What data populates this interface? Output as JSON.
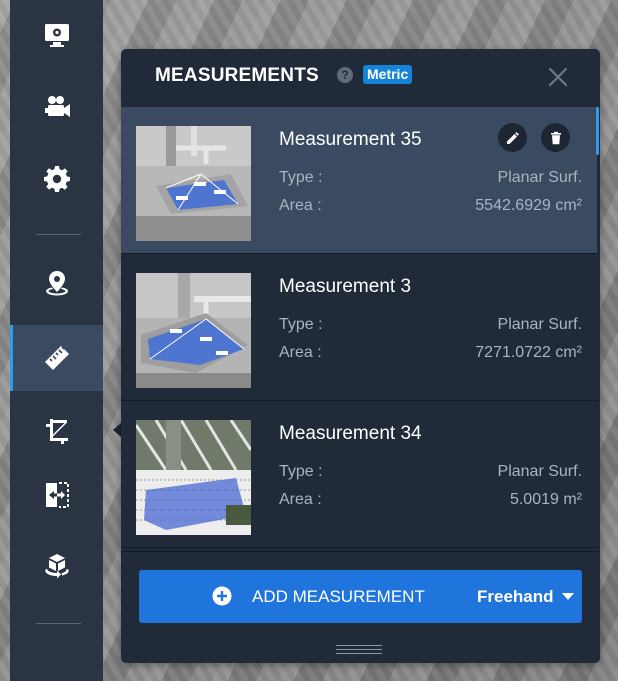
{
  "panel": {
    "title": "MEASUREMENTS",
    "help_glyph": "?",
    "unit_badge": "Metric"
  },
  "measurements": [
    {
      "name": "Measurement 35",
      "type_label": "Type :",
      "type_value": "Planar Surf.",
      "area_label": "Area :",
      "area_value": "5542.6929 cm²",
      "selected": true
    },
    {
      "name": "Measurement 3",
      "type_label": "Type :",
      "type_value": "Planar Surf.",
      "area_label": "Area :",
      "area_value": "7271.0722 cm²",
      "selected": false
    },
    {
      "name": "Measurement 34",
      "type_label": "Type :",
      "type_value": "Planar Surf.",
      "area_label": "Area :",
      "area_value": "5.0019 m²",
      "selected": false
    }
  ],
  "footer": {
    "add_label": "ADD MEASUREMENT",
    "mode_label": "Freehand"
  },
  "sidebar": {
    "items": [
      {
        "icon": "monitor-settings-icon",
        "active": false
      },
      {
        "icon": "video-camera-icon",
        "active": false
      },
      {
        "icon": "gear-icon",
        "active": false
      },
      {
        "icon": "map-pin-icon",
        "active": false
      },
      {
        "icon": "ruler-icon",
        "active": true
      },
      {
        "icon": "crop-icon",
        "active": false
      },
      {
        "icon": "split-view-icon",
        "active": false
      },
      {
        "icon": "cube-rotate-icon",
        "active": false
      }
    ]
  },
  "colors": {
    "accent": "#1f75dc",
    "badge": "#1584d8",
    "panel": "#212a38",
    "selected_row": "#3a4a60",
    "sidebar": "#2a3443"
  }
}
